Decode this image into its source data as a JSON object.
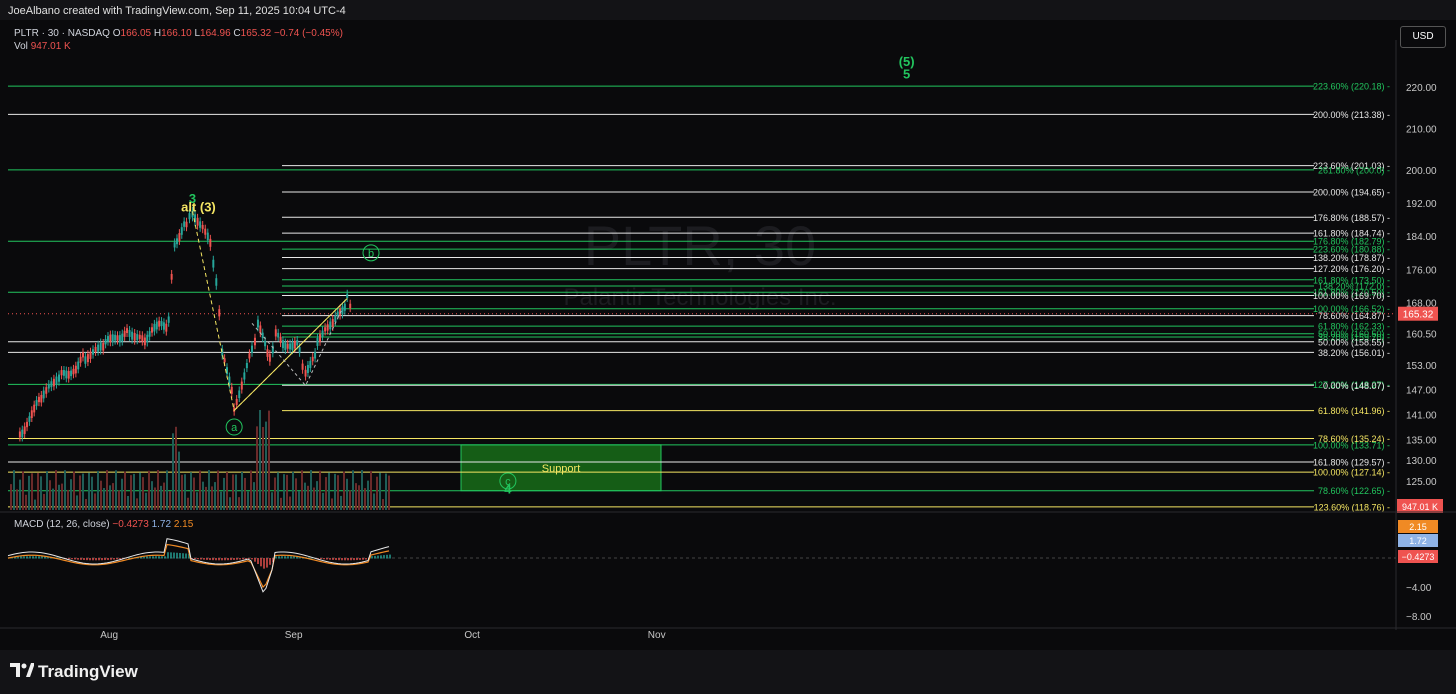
{
  "header": {
    "attribution": "JoeAlbano created with TradingView.com, Sep 11, 2025 10:04 UTC-4",
    "symbol": "PLTR · 30 · NASDAQ",
    "o_label": "O",
    "o_value": "166.05",
    "h_label": "H",
    "h_value": "166.10",
    "l_label": "L",
    "l_value": "164.96",
    "c_label": "C",
    "c_value": "165.32",
    "change": "−0.74 (−0.45%)",
    "vol_label": "Vol",
    "vol_value": "947.01 K"
  },
  "currency": "USD",
  "watermark": {
    "symbol": "PLTR, 30",
    "name": "Palantir Technologies Inc."
  },
  "branding": "TradingView",
  "colors": {
    "green": "#22c55e",
    "yellow": "#f5e663",
    "white": "#e8e8e8",
    "up": "#26a69a",
    "down": "#ef5350",
    "price_tag": "#ef5350",
    "support_fill": "#1a7a1a"
  },
  "chart_data": {
    "type": "candlestick",
    "symbol": "PLTR",
    "interval": "30",
    "exchange": "NASDAQ",
    "last_price": "165.32",
    "volume_tag": "947.01 K",
    "x_ticks": [
      "Aug",
      "Sep",
      "Oct",
      "Nov"
    ],
    "y_ticks": [
      "220.00",
      "210.00",
      "200.00",
      "192.00",
      "184.00",
      "176.00",
      "168.00",
      "160.50",
      "153.00",
      "147.00",
      "141.00",
      "135.00",
      "130.00",
      "125.00"
    ],
    "y_range": [
      118,
      226
    ],
    "price_path": [
      [
        "2025-07-17",
        137
      ],
      [
        "2025-07-21",
        145
      ],
      [
        "2025-07-24",
        150
      ],
      [
        "2025-07-28",
        155
      ],
      [
        "2025-07-31",
        157
      ],
      [
        "2025-08-04",
        162
      ],
      [
        "2025-08-07",
        160
      ],
      [
        "2025-08-11",
        163
      ],
      [
        "2025-08-12",
        183
      ],
      [
        "2025-08-14",
        187
      ],
      [
        "2025-08-15",
        190
      ],
      [
        "2025-08-18",
        182
      ],
      [
        "2025-08-19",
        173
      ],
      [
        "2025-08-20",
        157
      ],
      [
        "2025-08-22",
        143
      ],
      [
        "2025-08-25",
        158
      ],
      [
        "2025-08-26",
        162
      ],
      [
        "2025-08-28",
        155
      ],
      [
        "2025-08-29",
        160
      ],
      [
        "2025-09-02",
        157
      ],
      [
        "2025-09-03",
        150
      ],
      [
        "2025-09-05",
        158
      ],
      [
        "2025-09-08",
        163
      ],
      [
        "2025-09-10",
        169
      ],
      [
        "2025-09-11",
        165.32
      ]
    ],
    "waves": [
      {
        "label": "3",
        "color": "green",
        "date": "2025-08-15",
        "price": 192
      },
      {
        "label": "alt (3)",
        "color": "yellow",
        "date": "2025-08-16",
        "price": 190
      },
      {
        "label": "a",
        "circled": true,
        "color": "green",
        "date": "2025-08-22",
        "price": 138
      },
      {
        "label": "b",
        "circled": true,
        "color": "green",
        "date": "2025-09-14",
        "price": 180
      },
      {
        "label": "c",
        "circled": true,
        "color": "green",
        "date": "2025-10-07",
        "price": 125
      },
      {
        "label": "4",
        "color": "green",
        "date": "2025-10-07",
        "price": 122
      },
      {
        "label": "(5)",
        "color": "green",
        "date": "2025-12-13",
        "price": 225
      },
      {
        "label": "5",
        "color": "green",
        "date": "2025-12-13",
        "price": 222
      }
    ],
    "zones": [
      {
        "label": "Support",
        "top": 133.71,
        "bottom": 122.65,
        "color": "green"
      }
    ],
    "fib_levels": [
      {
        "label": "223.60% (220.18)",
        "price": 220.18,
        "color": "green",
        "start": "full"
      },
      {
        "label": "200.00% (213.38)",
        "price": 213.38,
        "color": "white",
        "start": "full"
      },
      {
        "label": "223.60% (201.03)",
        "price": 201.03,
        "color": "white",
        "start": "short"
      },
      {
        "label": "261.80% (200.0)",
        "price": 200.0,
        "color": "green",
        "start": "full"
      },
      {
        "label": "200.00% (194.65)",
        "price": 194.65,
        "color": "white",
        "start": "short"
      },
      {
        "label": "176.80% (188.57)",
        "price": 188.57,
        "color": "white",
        "start": "short"
      },
      {
        "label": "161.80% (184.74)",
        "price": 184.74,
        "color": "white",
        "start": "short"
      },
      {
        "label": "176.80% (182.79)",
        "price": 182.79,
        "color": "green",
        "start": "full"
      },
      {
        "label": "223.60% (180.88)",
        "price": 180.88,
        "color": "green",
        "start": "short"
      },
      {
        "label": "138.20% (178.87)",
        "price": 178.87,
        "color": "white",
        "start": "short"
      },
      {
        "label": "127.20% (176.20)",
        "price": 176.2,
        "color": "white",
        "start": "short"
      },
      {
        "label": "161.80% (173.50)",
        "price": 173.5,
        "color": "green",
        "start": "short"
      },
      {
        "label": "138.20% (172.0)",
        "price": 172.0,
        "color": "green",
        "start": "short"
      },
      {
        "label": "161.80% (170.50)",
        "price": 170.5,
        "color": "green",
        "start": "full"
      },
      {
        "label": "100.00% (169.70)",
        "price": 169.7,
        "color": "white",
        "start": "short"
      },
      {
        "label": "100.00% (166.52)",
        "price": 166.52,
        "color": "green",
        "start": "short"
      },
      {
        "label": "78.60% (164.87)",
        "price": 164.87,
        "color": "white",
        "start": "short"
      },
      {
        "label": "61.80% (162.33)",
        "price": 162.33,
        "color": "green",
        "start": "short"
      },
      {
        "label": "50.00% (160.50)",
        "price": 160.5,
        "color": "green",
        "start": "short"
      },
      {
        "label": "38.20% (159.70)",
        "price": 159.7,
        "color": "green",
        "start": "short"
      },
      {
        "label": "50.00% (158.55)",
        "price": 158.55,
        "color": "white",
        "start": "full"
      },
      {
        "label": "38.20% (156.01)",
        "price": 156.01,
        "color": "white",
        "start": "full"
      },
      {
        "label": "127.20% (148.27)",
        "price": 148.27,
        "color": "green",
        "start": "full"
      },
      {
        "label": "0.00% (148.07)",
        "price": 148.07,
        "color": "white",
        "start": "short"
      },
      {
        "label": "61.80% (141.96)",
        "price": 141.96,
        "color": "yellow",
        "start": "short"
      },
      {
        "label": "78.60% (135.24)",
        "price": 135.24,
        "color": "yellow",
        "start": "full"
      },
      {
        "label": "100.00% (133.71)",
        "price": 133.71,
        "color": "green",
        "start": "full"
      },
      {
        "label": "161.80% (129.57)",
        "price": 129.57,
        "color": "white",
        "start": "full"
      },
      {
        "label": "100.00% (127.14)",
        "price": 127.14,
        "color": "yellow",
        "start": "full"
      },
      {
        "label": "78.60% (122.65)",
        "price": 122.65,
        "color": "green",
        "start": "full"
      },
      {
        "label": "123.60% (118.76)",
        "price": 118.76,
        "color": "yellow",
        "start": "full"
      }
    ],
    "macd": {
      "label": "MACD (12, 26, close)",
      "histogram": "−0.4273",
      "macd": "1.72",
      "signal": "2.15",
      "y_ticks": [
        "−4.00",
        "−8.00"
      ],
      "tags": [
        {
          "text": "2.15",
          "color": "#f08a24"
        },
        {
          "text": "1.72",
          "color": "#8fb3e6"
        },
        {
          "text": "−0.4273",
          "color": "#ef5350"
        }
      ]
    }
  }
}
